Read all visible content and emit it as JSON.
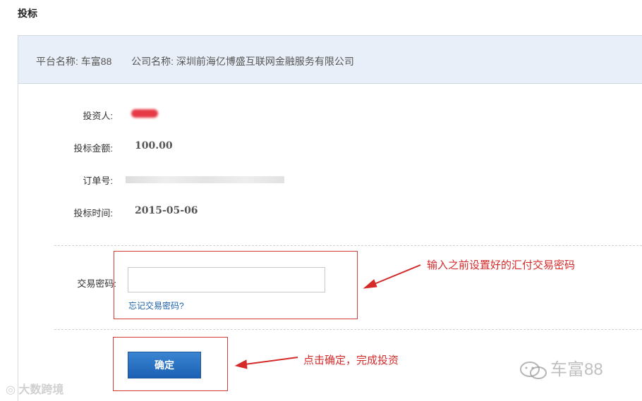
{
  "page": {
    "title": "投标"
  },
  "info_bar": {
    "platform_label": "平台名称:",
    "platform_value": "车富88",
    "company_label": "公司名称:",
    "company_value": "深圳前海亿博盛互联网金融服务有限公司"
  },
  "details": {
    "investor_label": "投资人:",
    "amount_label": "投标金额:",
    "amount_value": "100.00",
    "order_label": "订单号:",
    "time_label": "投标时间:",
    "time_value": "2015-05-06"
  },
  "password": {
    "label": "交易密码:",
    "value": "",
    "forgot_link": "忘记交易密码?"
  },
  "confirm_button": "确定",
  "annotations": {
    "password_hint": "输入之前设置好的汇付交易密码",
    "confirm_hint": "点击确定，完成投资"
  },
  "watermarks": {
    "left": "大数跨境",
    "right": "车富88"
  },
  "colors": {
    "info_bar_bg": "#e9eff8",
    "annotation_red": "#d42a2a",
    "button_blue": "#2670c2",
    "link_blue": "#1a5fa8"
  }
}
